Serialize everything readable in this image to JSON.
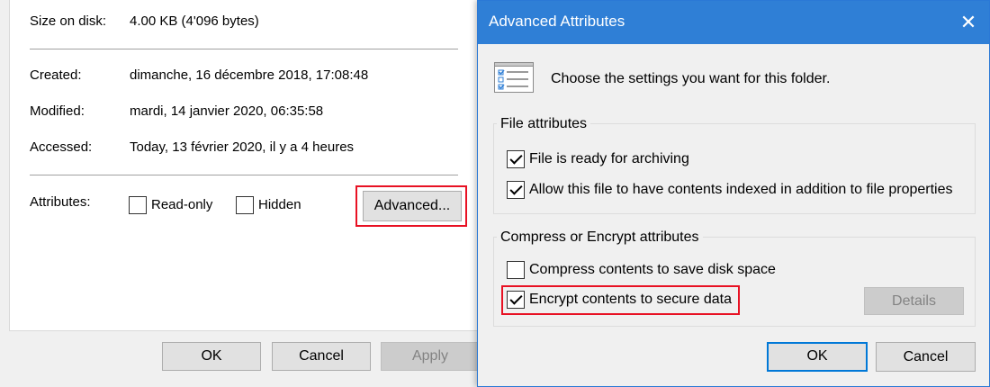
{
  "properties": {
    "size_on_disk": {
      "label": "Size on disk:",
      "value": "4.00 KB (4'096 bytes)"
    },
    "created": {
      "label": "Created:",
      "value": "dimanche, 16 décembre 2018, 17:08:48"
    },
    "modified": {
      "label": "Modified:",
      "value": "mardi, 14 janvier 2020, 06:35:58"
    },
    "accessed": {
      "label": "Accessed:",
      "value": "Today, 13 février 2020, il y a 4 heures"
    },
    "attributes": {
      "label": "Attributes:",
      "read_only": {
        "label": "Read-only",
        "checked": false
      },
      "hidden": {
        "label": "Hidden",
        "checked": false
      },
      "advanced_button": "Advanced..."
    },
    "buttons": {
      "ok": "OK",
      "cancel": "Cancel",
      "apply": "Apply"
    }
  },
  "advanced_dialog": {
    "title": "Advanced Attributes",
    "close_glyph": "✕",
    "description": "Choose the settings you want for this folder.",
    "file_attributes": {
      "heading": "File attributes",
      "archive": {
        "label": "File is ready for archiving",
        "checked": true
      },
      "index": {
        "label": "Allow this file to have contents indexed in addition to file properties",
        "checked": true
      }
    },
    "compress_encrypt": {
      "heading": "Compress or Encrypt attributes",
      "compress": {
        "label": "Compress contents to save disk space",
        "checked": false
      },
      "encrypt": {
        "label": "Encrypt contents to secure data",
        "checked": true
      },
      "details_button": "Details"
    },
    "buttons": {
      "ok": "OK",
      "cancel": "Cancel"
    }
  },
  "colors": {
    "accent": "#0078d7",
    "titlebar": "#2f7fd6",
    "highlight": "#e81123"
  }
}
